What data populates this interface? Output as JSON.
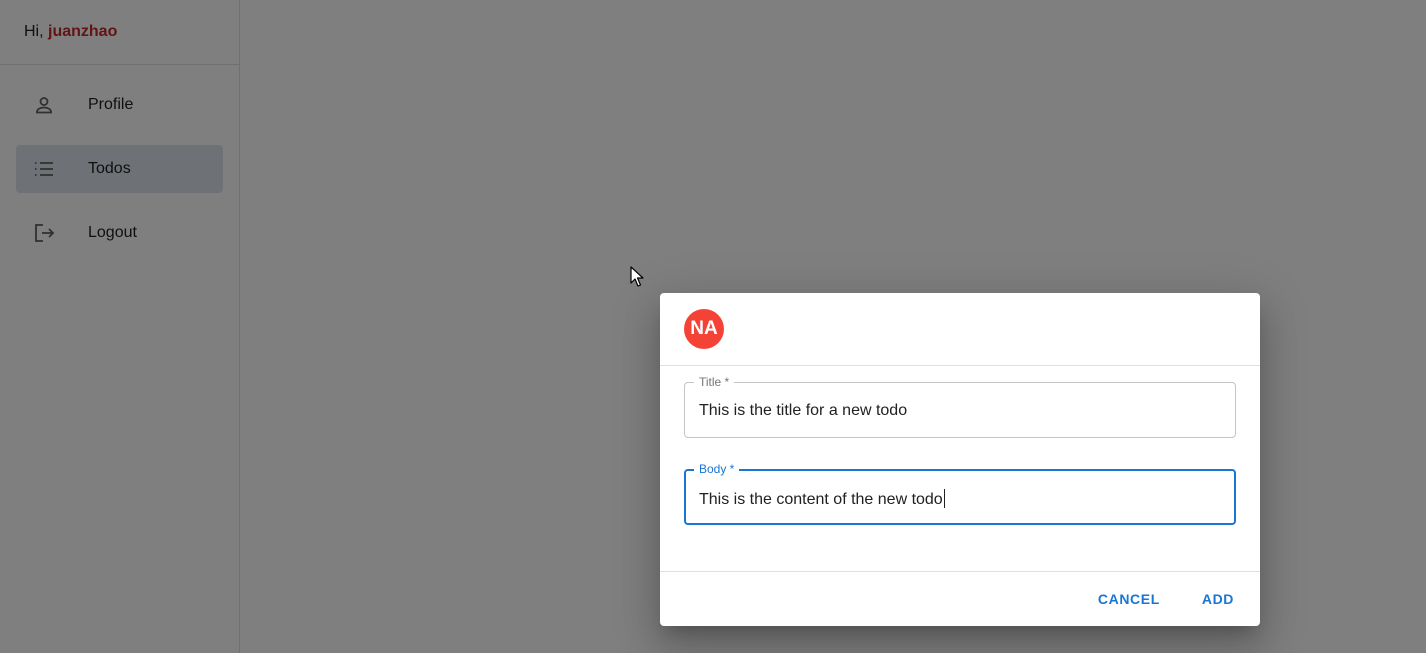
{
  "sidebar": {
    "greeting_prefix": "Hi, ",
    "username": "juanzhao",
    "items": [
      {
        "label": "Profile",
        "icon": "person-icon",
        "active": false
      },
      {
        "label": "Todos",
        "icon": "list-icon",
        "active": true
      },
      {
        "label": "Logout",
        "icon": "logout-icon",
        "active": false
      }
    ]
  },
  "dialog": {
    "avatar_initials": "NA",
    "title_field": {
      "label": "Title *",
      "value": "This is the title for a new todo"
    },
    "body_field": {
      "label": "Body *",
      "value": "This is the content of the new todo"
    },
    "cancel_label": "CANCEL",
    "add_label": "ADD"
  },
  "colors": {
    "accent": "#1976d2",
    "avatar": "#f44336",
    "username": "#c62828",
    "active_nav": "#dde5ec"
  }
}
